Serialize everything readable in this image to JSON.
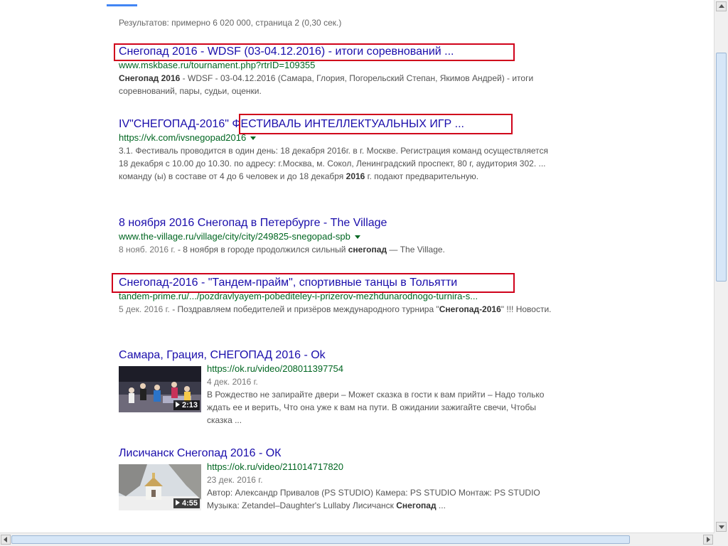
{
  "stats": "Результатов: примерно 6 020 000, страница 2 (0,30 сек.)",
  "results": [
    {
      "title": "Снегопад 2016 - WDSF (03-04.12.2016) - итоги соревнований ...",
      "url": "www.mskbase.ru/tournament.php?rtrID=109355",
      "snippet_bold": "Снегопад 2016",
      "snippet": " - WDSF - 03-04.12.2016 (Самара, Глория, Погорельский Степан, Якимов Андрей) - итоги соревнований, пары, судьи, оценки."
    },
    {
      "title": "IV\"СНЕГОПАД-2016\" ФЕСТИВАЛЬ ИНТЕЛЛЕКТУАЛЬНЫХ ИГР ...",
      "url": "https://vk.com/ivsnegopad2016",
      "snippet_a": "3.1. Фестиваль проводится в один день: 18 декабря 2016г. в г. Москве. Регистрация команд осуществляется 18 декабря с 10.00 до 10.30. по адресу: г.Москва, м. Сокол, Ленинградский проспект, 80 г, аудитория 302. ... команду (ы) в составе от 4 до 6 человек и до 18 декабря ",
      "snippet_bold": "2016",
      "snippet_b": " г. подают предварительную."
    },
    {
      "title": "8 ноября 2016 Снегопад в Петербурге - The Village",
      "url": "www.the-village.ru/village/city/city/249825-snegopad-spb",
      "date": "8 нояб. 2016 г.",
      "snippet_a": " - 8 ноября в городе продолжился сильный ",
      "snippet_bold": "снегопад",
      "snippet_b": " — The Village."
    },
    {
      "title": "Снегопад-2016 - \"Тандем-прайм\", спортивные танцы в Тольятти",
      "url": "tandem-prime.ru/.../pozdravlyayem-pobediteley-i-prizerov-mezhdunarodnogo-turnira-s...",
      "date": "5 дек. 2016 г.",
      "snippet_a": " - Поздравляем победителей и призёров международного турнира \"",
      "snippet_bold": "Снегопад-2016",
      "snippet_b": "\" !!! Новости."
    }
  ],
  "videos": [
    {
      "title": "Самара, Грация, СНЕГОПАД 2016 - Ok",
      "url": "https://ok.ru/video/208011397754",
      "date": "4 дек. 2016 г.",
      "snippet": "В Рождество не запирайте двери – Может сказка в гости к вам прийти – Надо только ждать ее и верить, Что она уже к вам на пути. В ожидании зажигайте свечи, Чтобы сказка ...",
      "duration": "2:13"
    },
    {
      "title": "Лисичанск Снегопад 2016 - ОК",
      "url": "https://ok.ru/video/211014717820",
      "date": "23 дек. 2016 г.",
      "snippet_a": "Автор: Александр Привалов (PS STUDIO) Камера: PS STUDIO Монтаж: PS STUDIO Музыка: Zetandel–Daughter's Lullaby Лисичанск ",
      "snippet_bold": "Снегопад",
      "snippet_b": " ...",
      "duration": "4:55"
    }
  ],
  "colors": {
    "link": "#1a0dab",
    "url": "#006621",
    "highlight": "#d0021b"
  }
}
